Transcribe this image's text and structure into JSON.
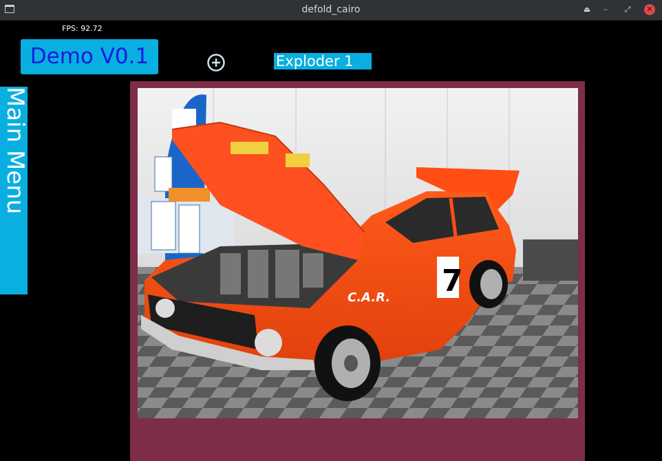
{
  "window": {
    "title": "defold_cairo",
    "controls": [
      "eject-icon",
      "minimize-icon",
      "maximize-icon",
      "close-icon"
    ]
  },
  "hud": {
    "fps": "FPS: 92.72",
    "demo_label": "Demo V0.1",
    "exploder_label": "Exploder 1",
    "main_menu_label": "Main Menu",
    "add_icon": "plus-circle-icon"
  },
  "colors": {
    "accent": "#08afe0",
    "demo_text": "#1a1ae0",
    "frame": "#7d2d47",
    "background": "#000000"
  },
  "image": {
    "subject": "car-photo",
    "car_number": "7",
    "decal": "C.A.R."
  }
}
